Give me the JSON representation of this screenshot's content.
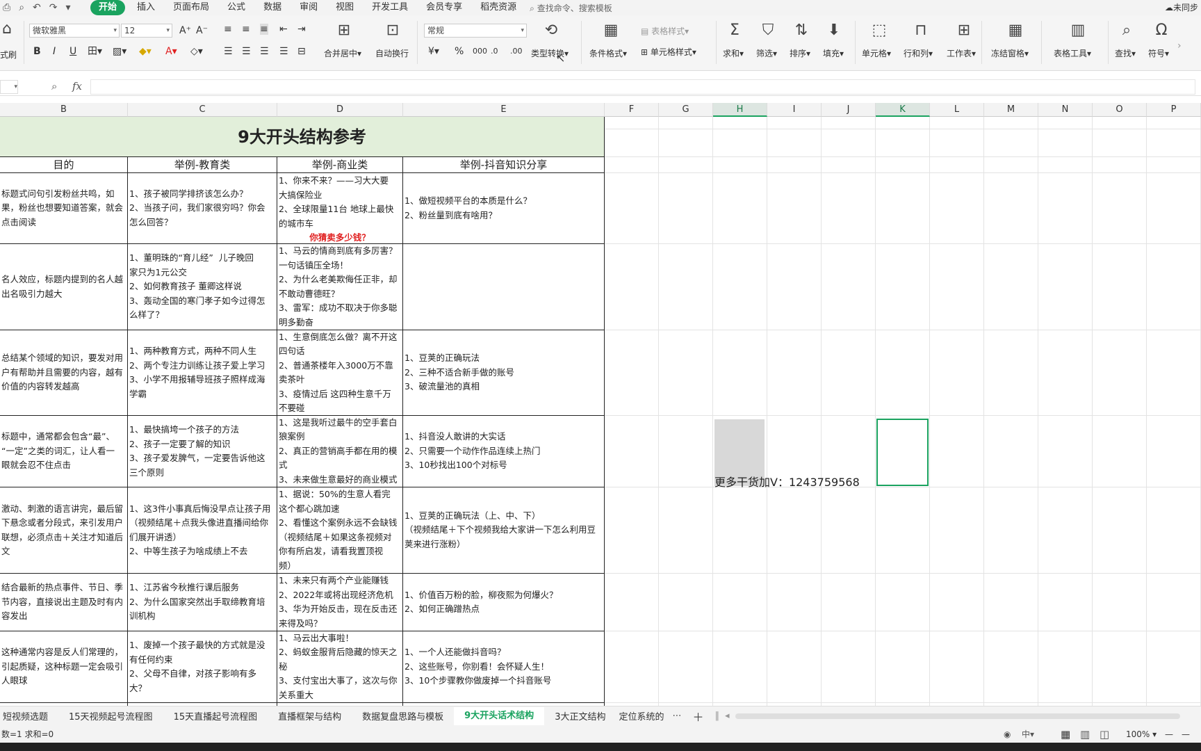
{
  "menu": {
    "tabs": [
      "开始",
      "插入",
      "页面布局",
      "公式",
      "数据",
      "审阅",
      "视图",
      "开发工具",
      "会员专享",
      "稻壳资源"
    ],
    "search": "查找命令、搜索模板",
    "sync": "未同步"
  },
  "ribbon": {
    "format_painter": "式刷",
    "font_name": "微软雅黑",
    "font_size": "12",
    "merge": "合并居中",
    "wrap": "自动换行",
    "number_format": "常规",
    "convert": "类型转换",
    "cond_format": "条件格式",
    "cell_style": "单元格样式",
    "table_style": "表格样式",
    "sum": "求和",
    "filter": "筛选",
    "sort": "排序",
    "fill": "填充",
    "cell": "单元格",
    "row_col": "行和列",
    "sheet": "工作表",
    "freeze": "冻结窗格",
    "table_tools": "表格工具",
    "find": "查找",
    "symbol": "符号"
  },
  "formula": {
    "fx": "fx",
    "value": ""
  },
  "columns": [
    "B",
    "C",
    "D",
    "E",
    "F",
    "G",
    "H",
    "I",
    "J",
    "K",
    "L",
    "M",
    "N",
    "O",
    "P"
  ],
  "sheet": {
    "title": "9大开头结构参考",
    "headers": [
      "目的",
      "举例-教育类",
      "举例-商业类",
      "举例-抖音知识分享"
    ],
    "rows": [
      {
        "b": "标题式问句引发粉丝共鸣，如\n果，粉丝也想要知道答案，就会\n点击阅读",
        "c": "1、孩子被同学排挤该怎么办？\n2、当孩子问，我们家很穷吗？你会\n怎么回答？",
        "d": "1、你来不来？——习大大要\n大搞保险业\n2、全球限量11台 地球上最快\n的城市车",
        "d_red": "你猜卖多少钱？",
        "e": "1、做短视频平台的本质是什么？\n2、粉丝量到底有啥用？"
      },
      {
        "b": "名人效应，标题内提到的名人越\n出名吸引力越大",
        "c": "1、董明珠的“育儿经”  儿子晚回\n家只为1元公交\n2、如何教育孩子 董卿这样说\n3、轰动全国的寒门孝子如今过得怎\n么样了？",
        "d": "1、马云的情商到底有多厉害？\n一句话镇压全场！\n2、为什么老美欺侮任正非，却\n不敢动曹德旺？\n3、雷军：成功不取决于你多聪\n明多勤奋",
        "e": ""
      },
      {
        "b": "总结某个领域的知识，要发对用\n户有帮助并且需要的内容，越有\n价值的内容转发越高",
        "c": "1、两种教育方式，两种不同人生\n2、两个专注力训练让孩子爱上学习\n3、小学不用报辅导班孩子照样成海\n学霸",
        "d": "1、生意倒底怎么做？离不开这\n四句话\n2、普通茶楼年入3000万不靠\n卖茶叶\n3、疫情过后 这四种生意千万\n不要碰",
        "e": "1、豆荚的正确玩法\n2、三种不适合新手做的账号\n3、破流量池的真相"
      },
      {
        "b": "标题中，通常都会包含“最”、\n“一定”之类的词汇，让人看一\n眼就会忍不住点击",
        "c": "1、最快搞垮一个孩子的方法\n2、孩子一定要了解的知识\n3、孩子爱发脾气，一定要告诉他这\n三个原则",
        "d": "1、这是我听过最牛的空手套白\n狼案例\n2、真正的营销高手都在用的模\n式\n3、未来做生意最好的商业模式",
        "e": "1、抖音没人敢讲的大实话\n2、只需要一个动作作品连续上热门\n3、10秒找出100个对标号"
      },
      {
        "b": "激动、刺激的语言讲完，最后留\n下悬念或者分段式，来引发用户\n联想，必须点击＋关注才知道后\n文",
        "c": "1、这3件小事真后悔没早点让孩子用\n（视频结尾＋点我头像进直播间给你\n们展开讲透）\n2、中等生孩子为啥成绩上不去",
        "d": "1、据说：50%的生意人看完\n这个都心跳加速\n2、看懂这个案例永远不会缺钱\n（视频结尾＋如果这条视频对\n你有所启发，请看我置顶视\n频）",
        "e": "1、豆荚的正确玩法（上、中、下）\n（视频结尾＋下个视频我给大家讲一下怎么利用豆\n荚来进行涨粉）"
      },
      {
        "b": "结合最新的热点事件、节日、季\n节内容，直接说出主题及时有内\n容发出",
        "c": "1、江苏省今秋推行课后服务\n2、为什么国家突然出手取缔教育培\n训机构",
        "d": "1、未来只有两个产业能赚钱\n2、2022年或将出现经济危机\n3、华为开始反击，现在反击还\n来得及吗？",
        "e": "1、价值百万粉的脸，柳夜熙为何爆火？\n2、如何正确蹭热点"
      },
      {
        "b": "这种通常内容是反人们常理的，\n引起质疑，这种标题一定会吸引\n人眼球",
        "c": "1、废掉一个孩子最快的方式就是没\n有任何约束\n2、父母不自律，对孩子影响有多\n大？",
        "d": "1、马云出大事啦！\n2、蚂蚁金服背后隐藏的惊天之\n秘\n3、支付宝出大事了，这次与你\n关系重大",
        "e": "1、一个人还能做抖音吗？\n2、这些账号，你别看！会怀疑人生！\n3、10个步骤教你做废掉一个抖音账号"
      },
      {
        "b": "",
        "c": "",
        "d": "",
        "e": ""
      }
    ],
    "floating_text": "更多干货加V：1243759568"
  },
  "tabs": [
    "短视频选题",
    "15天视频起号流程图",
    "15天直播起号流程图",
    "直播框架与结构",
    "数据复盘思路与模板",
    "9大开头话术结构",
    "3大正文结构",
    "定位系统的"
  ],
  "active_tab": "9大开头话术结构",
  "status": {
    "left": "数=1  求和=0",
    "zoom": "100%",
    "ime": "中"
  }
}
